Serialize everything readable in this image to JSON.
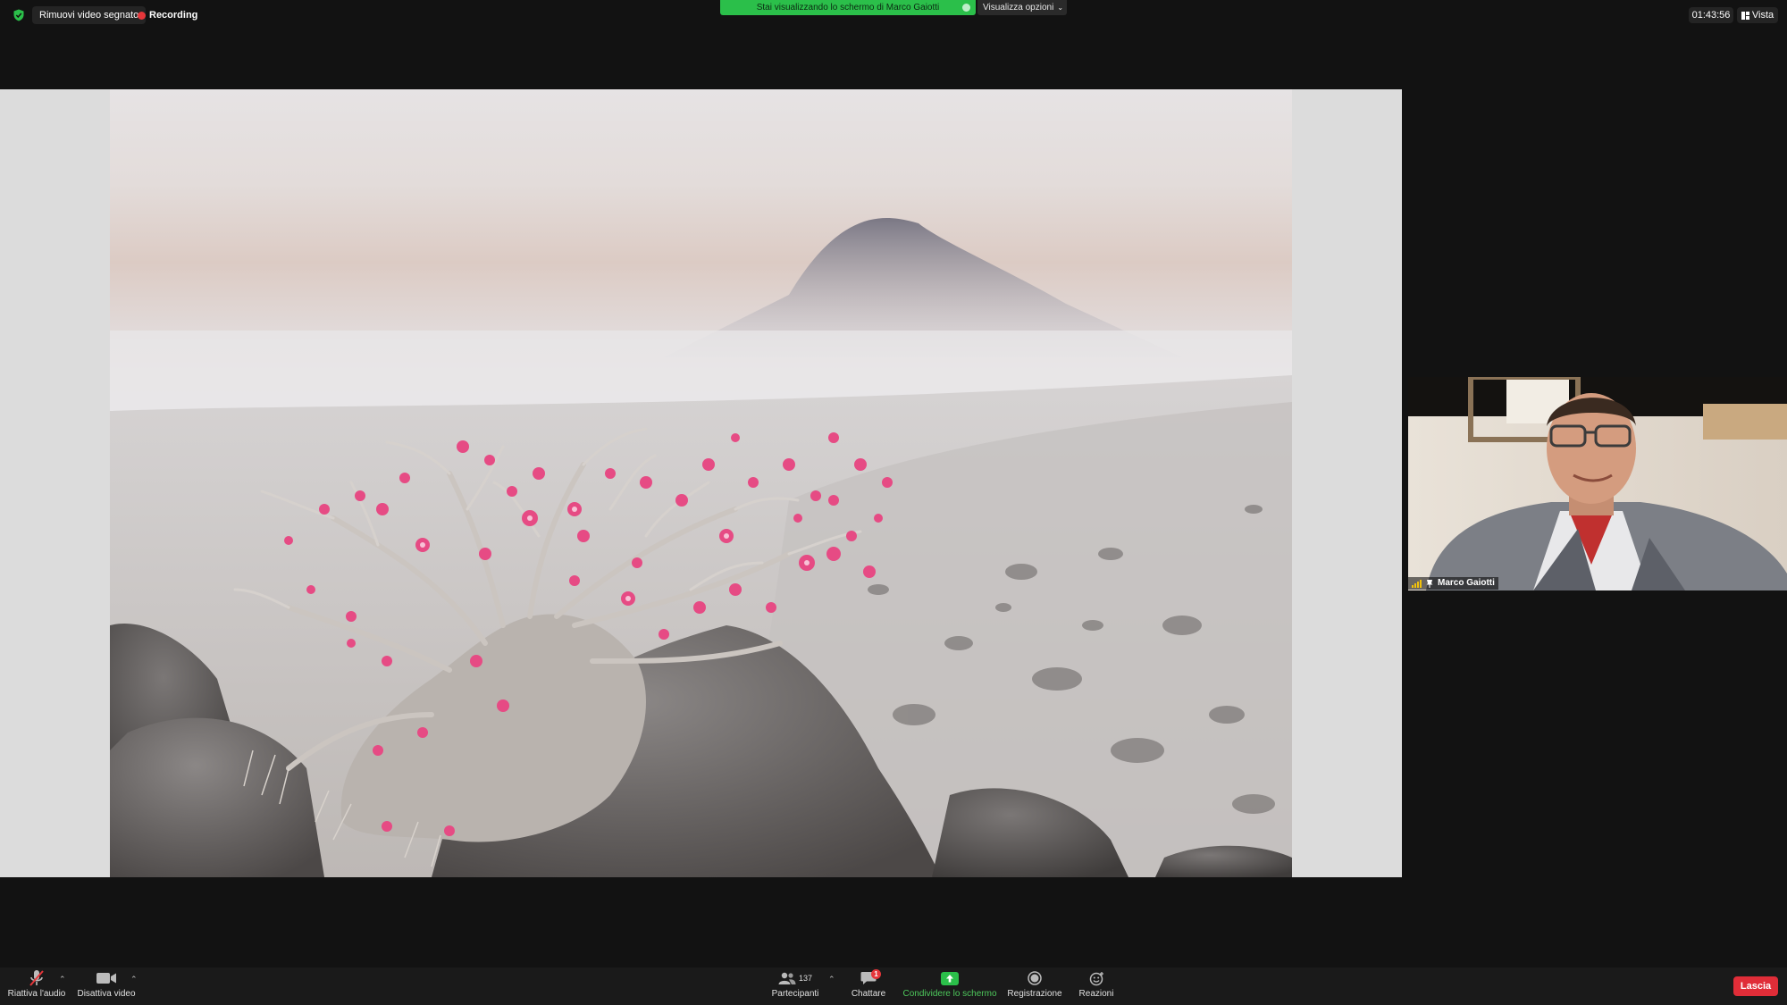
{
  "topbar": {
    "remove_video_label": "Rimuovi video segnato",
    "recording_label": "Recording",
    "share_banner": "Stai visualizzando lo schermo di Marco Gaiotti",
    "view_options_label": "Visualizza opzioni",
    "clock": "01:43:56",
    "view_label": "Vista"
  },
  "participant": {
    "name": "Marco Gaiotti"
  },
  "toolbar": {
    "audio_label": "Riattiva l'audio",
    "video_label": "Disattiva video",
    "participants_label": "Partecipanti",
    "participants_count": "137",
    "chat_label": "Chattare",
    "chat_badge": "1",
    "share_label": "Condividere lo schermo",
    "record_label": "Registrazione",
    "reactions_label": "Reazioni",
    "leave_label": "Lascia"
  },
  "colors": {
    "accent_green": "#2bbf4a",
    "leave_red": "#e02d38",
    "recording_red": "#e5363a",
    "signal_yellow": "#f2c20b"
  }
}
